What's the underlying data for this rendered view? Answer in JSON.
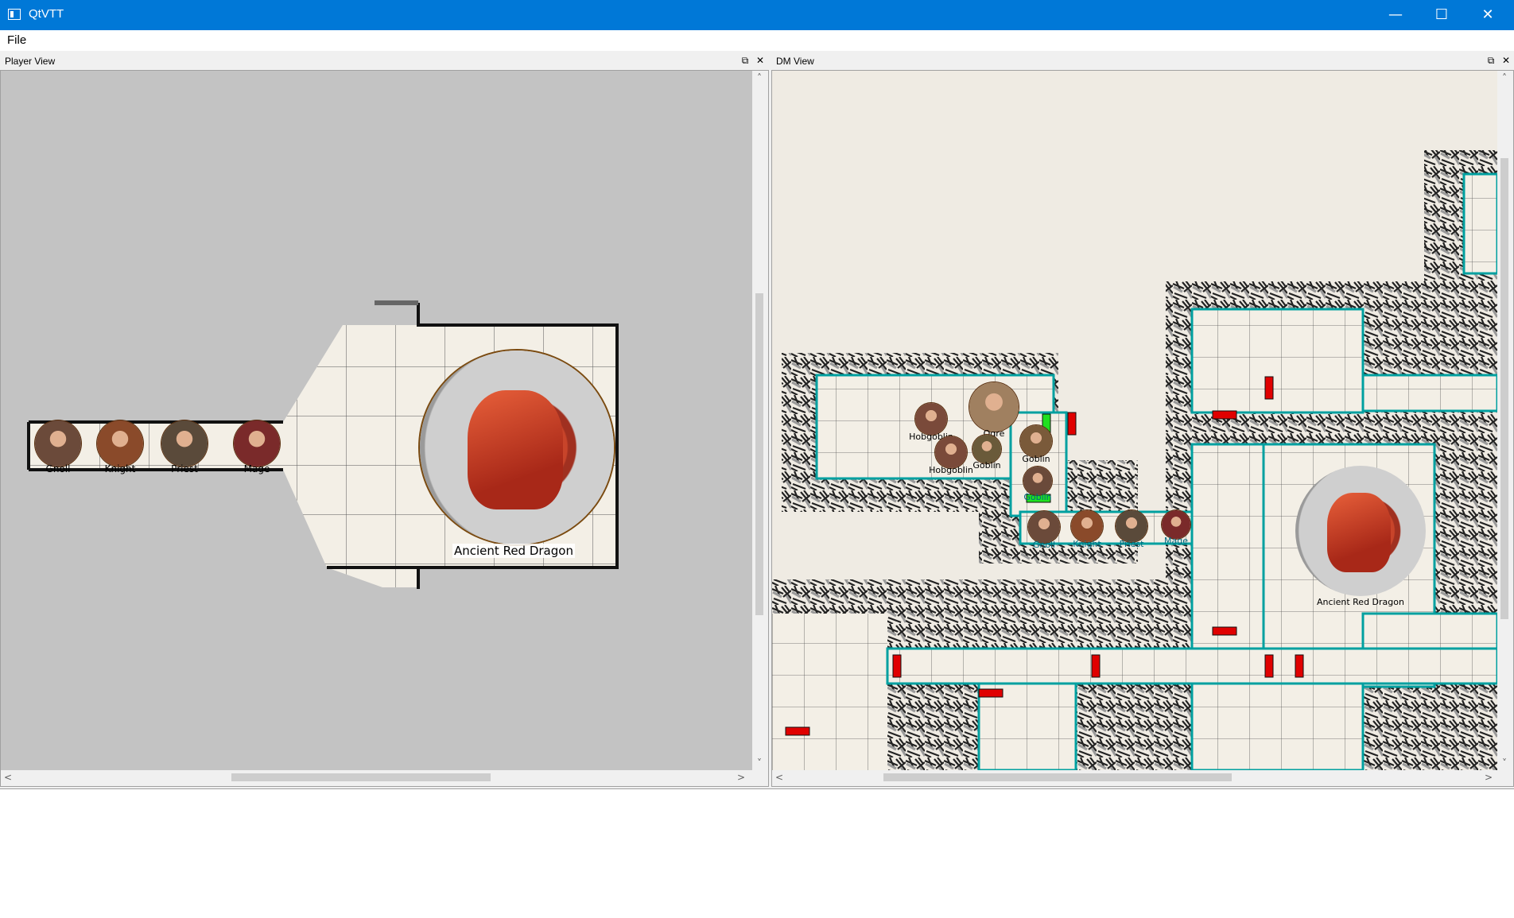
{
  "window": {
    "title": "QtVTT",
    "minimize": "—",
    "maximize": "☐",
    "close": "✕"
  },
  "menu": {
    "file": "File"
  },
  "player_view": {
    "title": "Player View",
    "float_icon": "⧉",
    "close_icon": "✕",
    "tokens": [
      {
        "label": "Gnoll",
        "color": "#6b4a3a"
      },
      {
        "label": "Knight",
        "color": "#8a4a2a"
      },
      {
        "label": "Priest",
        "color": "#5a4a3a"
      },
      {
        "label": "Mage",
        "color": "#7a2a2a"
      }
    ],
    "dragon_label": "Ancient Red Dragon"
  },
  "dm_view": {
    "title": "DM View",
    "float_icon": "⧉",
    "close_icon": "✕",
    "tokens": [
      {
        "label": "Hobgoblin",
        "color": "#7a4a3a"
      },
      {
        "label": "Ogre",
        "color": "#a08060"
      },
      {
        "label": "Goblin",
        "color": "#7a5a3a"
      },
      {
        "label": "Hobgoblin",
        "color": "#7a4a3a"
      },
      {
        "label": "Goblin",
        "color": "#6a5a3a"
      },
      {
        "label": "Goblin",
        "color": "#6a4a3a"
      },
      {
        "label": "Gnoll",
        "color": "#6b4a3a"
      },
      {
        "label": "Knight",
        "color": "#8a4a2a"
      },
      {
        "label": "Priest",
        "color": "#5a4a3a"
      },
      {
        "label": "Mage",
        "color": "#7a2a2a"
      }
    ],
    "dragon_label": "Ancient Red Dragon"
  },
  "scroll": {
    "up": "˄",
    "down": "˅",
    "left": "<",
    "right": ">"
  },
  "colors": {
    "titlebar": "#0078d7",
    "wall_edge": "#00b0b0",
    "door_closed": "#e00000",
    "door_open": "#20e020",
    "floor": "#f3efe6",
    "fog": "#c3c3c3"
  }
}
